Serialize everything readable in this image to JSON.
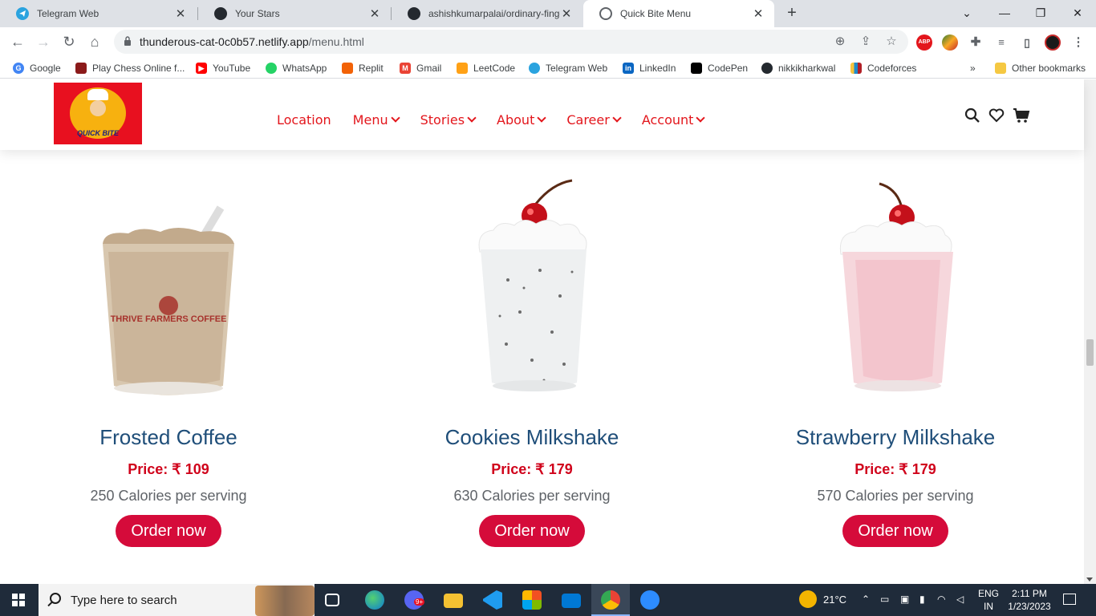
{
  "browser": {
    "tabs": [
      {
        "title": "Telegram Web",
        "icon": "telegram-icon",
        "color": "#2aa3df"
      },
      {
        "title": "Your Stars",
        "icon": "github-icon",
        "color": "#24292f"
      },
      {
        "title": "ashishkumarpalai/ordinary-finge",
        "icon": "github-icon",
        "color": "#24292f"
      },
      {
        "title": "Quick Bite Menu",
        "icon": "globe-icon",
        "color": "#5f6368"
      }
    ],
    "url_host": "thunderous-cat-0c0b57.netlify.app",
    "url_path": "/menu.html",
    "bookmarks": [
      {
        "label": "Google",
        "icon": "google-icon",
        "color": "#4285f4"
      },
      {
        "label": "Play Chess Online f...",
        "icon": "chess-icon",
        "color": "#8b1a1a"
      },
      {
        "label": "YouTube",
        "icon": "youtube-icon",
        "color": "#ff0000"
      },
      {
        "label": "WhatsApp",
        "icon": "whatsapp-icon",
        "color": "#25d366"
      },
      {
        "label": "Replit",
        "icon": "replit-icon",
        "color": "#f26207"
      },
      {
        "label": "Gmail",
        "icon": "gmail-icon",
        "color": "#ea4335"
      },
      {
        "label": "LeetCode",
        "icon": "leetcode-icon",
        "color": "#ffa116"
      },
      {
        "label": "Telegram Web",
        "icon": "telegram-icon",
        "color": "#2aa3df"
      },
      {
        "label": "LinkedIn",
        "icon": "linkedin-icon",
        "color": "#0a66c2"
      },
      {
        "label": "CodePen",
        "icon": "codepen-icon",
        "color": "#000000"
      },
      {
        "label": "nikkikharkwal",
        "icon": "github-icon",
        "color": "#24292f"
      },
      {
        "label": "Codeforces",
        "icon": "codeforces-icon",
        "color": "#1f8acb"
      }
    ],
    "other_bookmarks": "Other bookmarks",
    "more_bookmarks": "»"
  },
  "site": {
    "logo_text": "QUICK BITE",
    "nav": [
      {
        "label": "Location",
        "has_dropdown": false
      },
      {
        "label": "Menu",
        "has_dropdown": true
      },
      {
        "label": "Stories",
        "has_dropdown": true
      },
      {
        "label": "About",
        "has_dropdown": true
      },
      {
        "label": "Career",
        "has_dropdown": true
      },
      {
        "label": "Account",
        "has_dropdown": true
      }
    ],
    "accent_color": "#e3161c"
  },
  "products": [
    {
      "name": "Frosted Coffee",
      "price": "Price: ₹ 109",
      "calories": "250 Calories per serving",
      "button": "Order now",
      "cup_label": "THRIVE FARMERS COFFEE"
    },
    {
      "name": "Cookies Milkshake",
      "price": "Price: ₹ 179",
      "calories": "630 Calories per serving",
      "button": "Order now"
    },
    {
      "name": "Strawberry Milkshake",
      "price": "Price: ₹ 179",
      "calories": "570 Calories per serving",
      "button": "Order now"
    }
  ],
  "taskbar": {
    "search_placeholder": "Type here to search",
    "weather": "21°C",
    "lang_top": "ENG",
    "lang_bottom": "IN",
    "time": "2:11 PM",
    "date": "1/23/2023",
    "notif_badge": "9+"
  }
}
